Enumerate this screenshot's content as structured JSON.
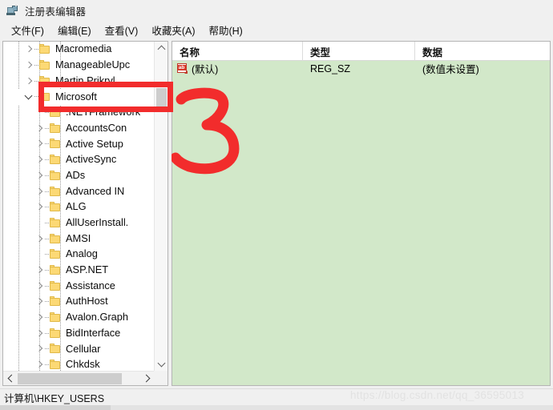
{
  "window": {
    "title": "注册表编辑器",
    "icon": "registry-editor-icon"
  },
  "menu": {
    "items": [
      {
        "label": "文件(F)"
      },
      {
        "label": "编辑(E)"
      },
      {
        "label": "查看(V)"
      },
      {
        "label": "收藏夹(A)"
      },
      {
        "label": "帮助(H)"
      }
    ]
  },
  "tree": {
    "items": [
      {
        "label": "Macromedia",
        "indent": 2,
        "state": "collapsed",
        "selected": false
      },
      {
        "label": "ManageableUpc",
        "indent": 2,
        "state": "collapsed",
        "selected": false
      },
      {
        "label": "Martin Prikryl",
        "indent": 2,
        "state": "collapsed",
        "selected": false
      },
      {
        "label": "Microsoft",
        "indent": 2,
        "state": "expanded",
        "selected": true
      },
      {
        "label": ".NETFramework",
        "indent": 3,
        "state": "leaf",
        "selected": false
      },
      {
        "label": "AccountsCon",
        "indent": 3,
        "state": "collapsed",
        "selected": false
      },
      {
        "label": "Active Setup",
        "indent": 3,
        "state": "collapsed",
        "selected": false
      },
      {
        "label": "ActiveSync",
        "indent": 3,
        "state": "collapsed",
        "selected": false
      },
      {
        "label": "ADs",
        "indent": 3,
        "state": "collapsed",
        "selected": false
      },
      {
        "label": "Advanced IN",
        "indent": 3,
        "state": "collapsed",
        "selected": false
      },
      {
        "label": "ALG",
        "indent": 3,
        "state": "collapsed",
        "selected": false
      },
      {
        "label": "AllUserInstall.",
        "indent": 3,
        "state": "leaf",
        "selected": false
      },
      {
        "label": "AMSI",
        "indent": 3,
        "state": "collapsed",
        "selected": false
      },
      {
        "label": "Analog",
        "indent": 3,
        "state": "leaf",
        "selected": false
      },
      {
        "label": "ASP.NET",
        "indent": 3,
        "state": "collapsed",
        "selected": false
      },
      {
        "label": "Assistance",
        "indent": 3,
        "state": "collapsed",
        "selected": false
      },
      {
        "label": "AuthHost",
        "indent": 3,
        "state": "collapsed",
        "selected": false
      },
      {
        "label": "Avalon.Graph",
        "indent": 3,
        "state": "collapsed",
        "selected": false
      },
      {
        "label": "BidInterface",
        "indent": 3,
        "state": "collapsed",
        "selected": false
      },
      {
        "label": "Cellular",
        "indent": 3,
        "state": "collapsed",
        "selected": false
      },
      {
        "label": "Chkdsk",
        "indent": 3,
        "state": "collapsed",
        "selected": false
      }
    ]
  },
  "list": {
    "columns": [
      "名称",
      "类型",
      "数据"
    ],
    "rows": [
      {
        "name": "(默认)",
        "type": "REG_SZ",
        "data": "(数值未设置)",
        "icon": "string-value-icon"
      }
    ]
  },
  "status": {
    "path": "计算机\\HKEY_USERS"
  },
  "annotations": {
    "number_label": "3",
    "marker_color": "#f22c2c",
    "highlight_target": "Microsoft"
  },
  "watermark": {
    "text": "https://blog.csdn.net/qq_36595013"
  },
  "colors": {
    "list_background": "#d2e8c9",
    "folder": "#fcd975",
    "accent_red": "#f22c2c"
  }
}
